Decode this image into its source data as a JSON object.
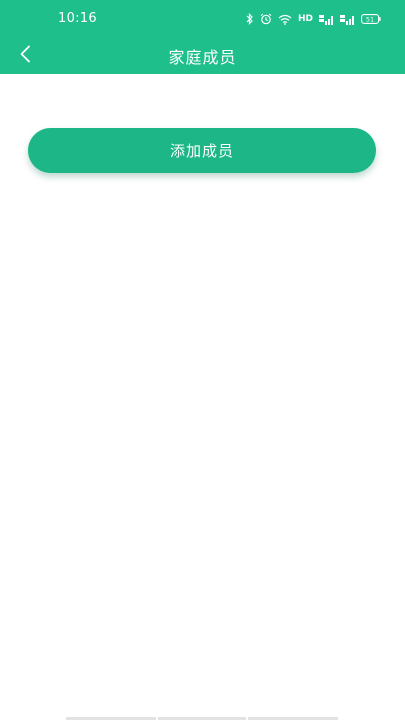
{
  "status_bar": {
    "time": "10:16",
    "hd": "HD",
    "battery": "51"
  },
  "header": {
    "title": "家庭成员",
    "back_icon": "chevron-left-icon"
  },
  "main": {
    "add_member_label": "添加成员"
  },
  "colors": {
    "header_bg": "#1fbf8c",
    "button_bg": "#1db787",
    "text_on_accent": "#ffffff"
  }
}
